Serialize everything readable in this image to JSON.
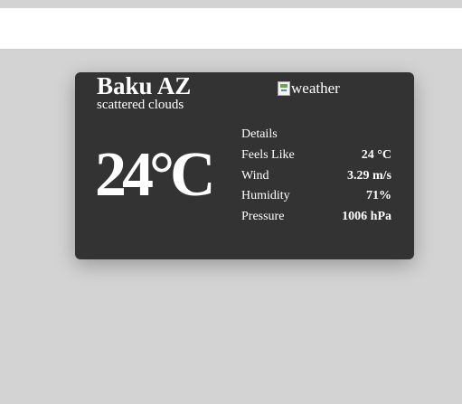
{
  "card": {
    "city": "Baku AZ",
    "description": "scattered clouds",
    "image_alt": "weather",
    "temperature": "24°C",
    "details_title": "Details",
    "details": [
      {
        "label": "Feels Like",
        "value": "24 °C"
      },
      {
        "label": "Wind",
        "value": "3.29 m/s"
      },
      {
        "label": "Humidity",
        "value": "71%"
      },
      {
        "label": "Pressure",
        "value": "1006 hPa"
      }
    ]
  },
  "colors": {
    "page_background": "#d3d3d3",
    "top_bar": "#ffffff",
    "card_background": "#333333",
    "card_text": "#ffffff"
  }
}
